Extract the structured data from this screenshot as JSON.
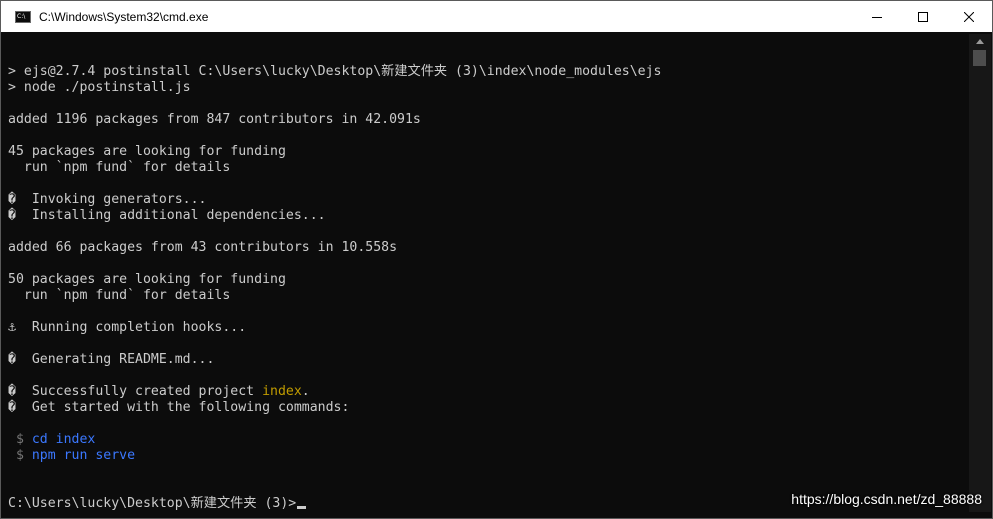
{
  "window": {
    "title": "C:\\Windows\\System32\\cmd.exe"
  },
  "console": {
    "lines": [
      {
        "parts": [
          {
            "t": "> ejs@2.7.4 postinstall C:\\Users\\lucky\\Desktop\\新建文件夹 (3)\\index\\node_modules\\ejs",
            "c": ""
          }
        ]
      },
      {
        "parts": [
          {
            "t": "> node ./postinstall.js",
            "c": ""
          }
        ]
      },
      {
        "parts": [
          {
            "t": "",
            "c": ""
          }
        ]
      },
      {
        "parts": [
          {
            "t": "added 1196 packages from 847 contributors in 42.091s",
            "c": ""
          }
        ]
      },
      {
        "parts": [
          {
            "t": "",
            "c": ""
          }
        ]
      },
      {
        "parts": [
          {
            "t": "45 packages are looking for funding",
            "c": ""
          }
        ]
      },
      {
        "parts": [
          {
            "t": "  run `npm fund` for details",
            "c": ""
          }
        ]
      },
      {
        "parts": [
          {
            "t": "",
            "c": ""
          }
        ]
      },
      {
        "parts": [
          {
            "t": "�  Invoking generators...",
            "c": ""
          }
        ]
      },
      {
        "parts": [
          {
            "t": "�  Installing additional dependencies...",
            "c": ""
          }
        ]
      },
      {
        "parts": [
          {
            "t": "",
            "c": ""
          }
        ]
      },
      {
        "parts": [
          {
            "t": "added 66 packages from 43 contributors in 10.558s",
            "c": ""
          }
        ]
      },
      {
        "parts": [
          {
            "t": "",
            "c": ""
          }
        ]
      },
      {
        "parts": [
          {
            "t": "50 packages are looking for funding",
            "c": ""
          }
        ]
      },
      {
        "parts": [
          {
            "t": "  run `npm fund` for details",
            "c": ""
          }
        ]
      },
      {
        "parts": [
          {
            "t": "",
            "c": ""
          }
        ]
      },
      {
        "parts": [
          {
            "t": "⚓  Running completion hooks...",
            "c": ""
          }
        ]
      },
      {
        "parts": [
          {
            "t": "",
            "c": ""
          }
        ]
      },
      {
        "parts": [
          {
            "t": "�  Generating README.md...",
            "c": ""
          }
        ]
      },
      {
        "parts": [
          {
            "t": "",
            "c": ""
          }
        ]
      },
      {
        "parts": [
          {
            "t": "�  Successfully created project ",
            "c": ""
          },
          {
            "t": "index",
            "c": "y"
          },
          {
            "t": ".",
            "c": ""
          }
        ]
      },
      {
        "parts": [
          {
            "t": "�  Get started with the following commands:",
            "c": ""
          }
        ]
      },
      {
        "parts": [
          {
            "t": "",
            "c": ""
          }
        ]
      },
      {
        "parts": [
          {
            "t": " $ ",
            "c": "g"
          },
          {
            "t": "cd index",
            "c": "b"
          }
        ]
      },
      {
        "parts": [
          {
            "t": " $ ",
            "c": "g"
          },
          {
            "t": "npm run serve",
            "c": "b"
          }
        ]
      },
      {
        "parts": [
          {
            "t": "",
            "c": ""
          }
        ]
      },
      {
        "parts": [
          {
            "t": "",
            "c": ""
          }
        ]
      },
      {
        "parts": [
          {
            "t": "C:\\Users\\lucky\\Desktop\\新建文件夹 (3)>",
            "c": ""
          }
        ]
      }
    ]
  },
  "watermark": "https://blog.csdn.net/zd_88888",
  "icons": {
    "app": "cmd-icon",
    "minimize": "minimize-icon",
    "maximize": "maximize-icon",
    "close": "close-icon",
    "scroll_up": "scroll-up-arrow-icon"
  }
}
